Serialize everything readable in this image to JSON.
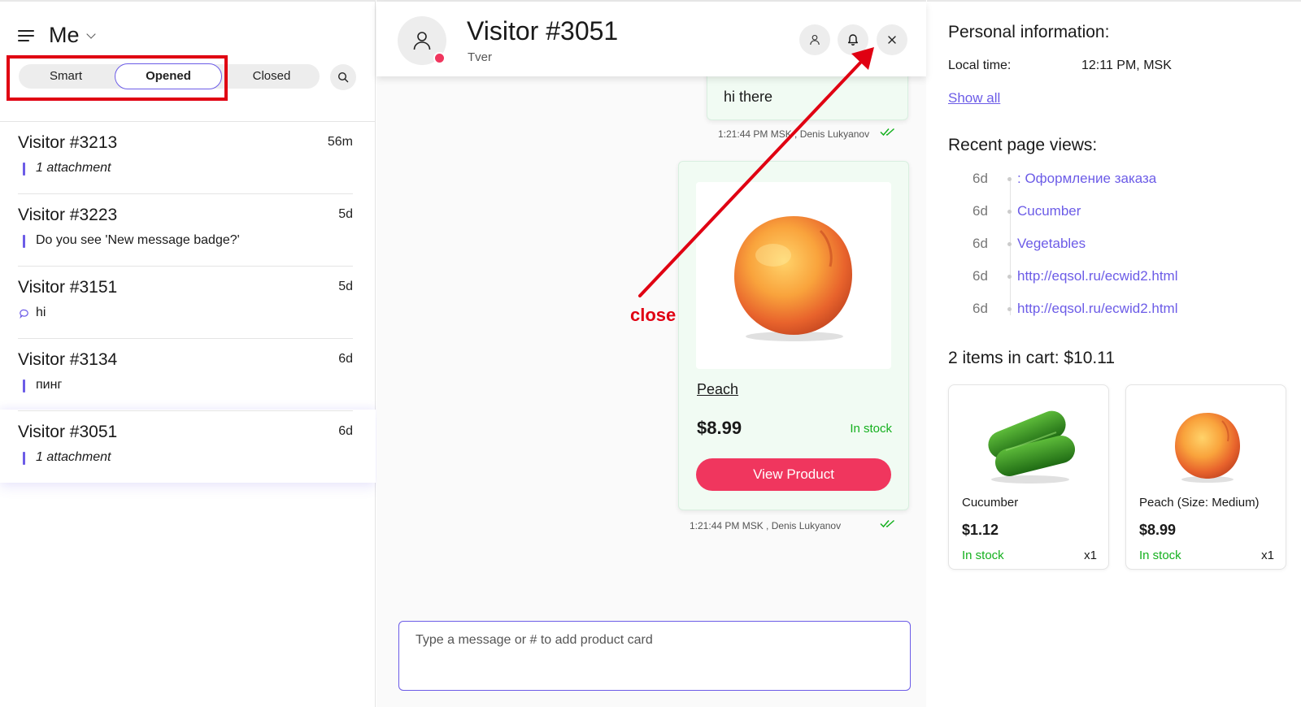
{
  "sidebar": {
    "owner_label": "Me",
    "filters": {
      "smart": "Smart",
      "opened": "Opened",
      "closed": "Closed",
      "active": "Opened"
    },
    "conversations": [
      {
        "title": "Visitor #3213",
        "time": "56m",
        "preview": "1 attachment",
        "preview_style": "italic",
        "marker": "bar"
      },
      {
        "title": "Visitor #3223",
        "time": "5d",
        "preview": "Do you see 'New message badge?'",
        "preview_style": "normal",
        "marker": "bar"
      },
      {
        "title": "Visitor #3151",
        "time": "5d",
        "preview": "hi",
        "preview_style": "normal",
        "marker": "chat-bubble"
      },
      {
        "title": "Visitor #3134",
        "time": "6d",
        "preview": "пинг",
        "preview_style": "normal",
        "marker": "bar"
      },
      {
        "title": "Visitor #3051",
        "time": "6d",
        "preview": "1 attachment",
        "preview_style": "italic",
        "marker": "bar",
        "selected": true
      }
    ]
  },
  "chat": {
    "title": "Visitor #3051",
    "location": "Tver",
    "messages": [
      {
        "text": "hi there",
        "meta": "1:21:44 PM MSK , Denis Lukyanov"
      },
      {
        "product": {
          "name": "Peach",
          "price": "$8.99",
          "stock": "In stock",
          "button": "View Product",
          "image_icon": "peach-image"
        },
        "meta": "1:21:44 PM MSK , Denis Lukyanov"
      }
    ],
    "composer_placeholder": "Type a message or # to add product card",
    "annotation": "close"
  },
  "visitor_info": {
    "personal_title": "Personal information:",
    "local_time_label": "Local time:",
    "local_time_value": "12:11 PM, MSK",
    "show_all": "Show all",
    "page_views_title": "Recent page views:",
    "page_views": [
      {
        "age": "6d",
        "page": ": Оформление заказа"
      },
      {
        "age": "6d",
        "page": "Cucumber"
      },
      {
        "age": "6d",
        "page": "Vegetables"
      },
      {
        "age": "6d",
        "page": "http://eqsol.ru/ecwid2.html"
      },
      {
        "age": "6d",
        "page": "http://eqsol.ru/ecwid2.html"
      }
    ],
    "cart_title": "2 items in cart: $10.11",
    "cart_items": [
      {
        "name": "Cucumber",
        "price": "$1.12",
        "stock": "In stock",
        "qty": "x1",
        "image_icon": "cucumber-image"
      },
      {
        "name": "Peach (Size: Medium)",
        "price": "$8.99",
        "stock": "In stock",
        "qty": "x1",
        "image_icon": "peach-image"
      }
    ]
  },
  "colors": {
    "accent": "#6c5ce7",
    "primary_button": "#f0365e",
    "in_stock": "#14b01e",
    "annotation": "#e00012",
    "message_bg": "#f1fbf3"
  }
}
